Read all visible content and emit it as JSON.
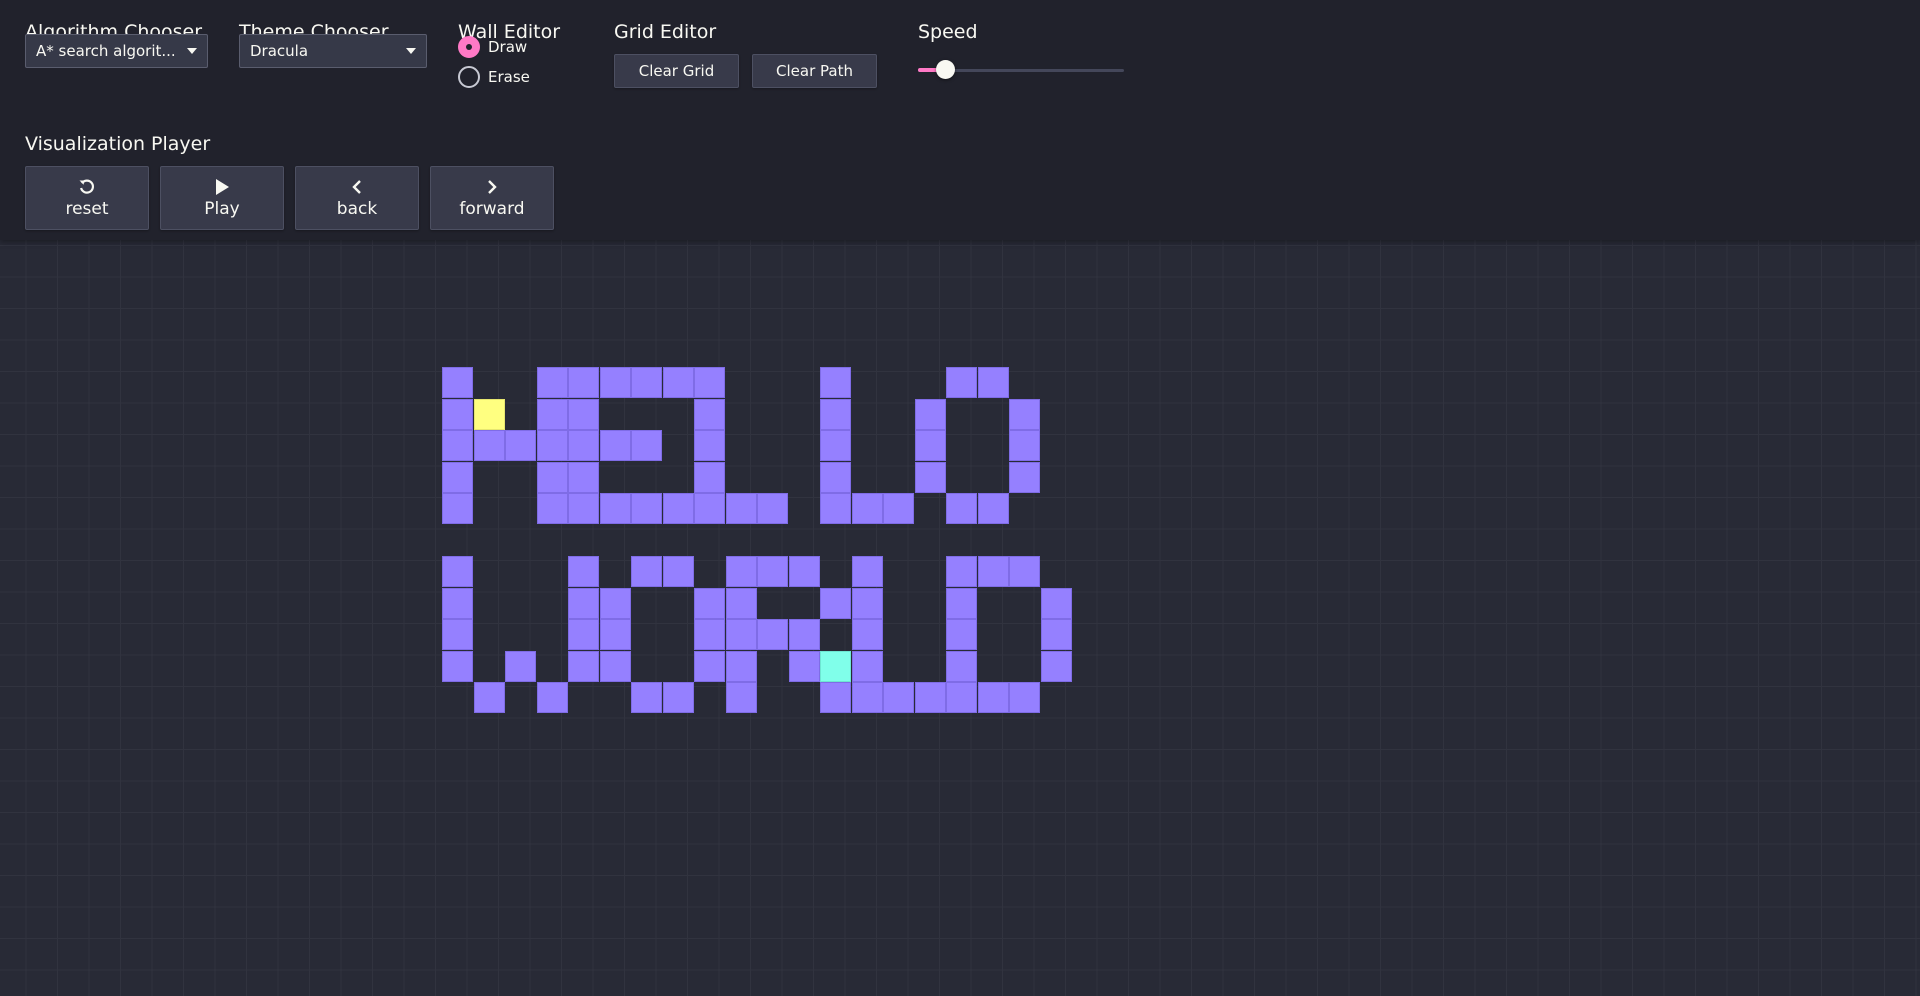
{
  "toolbar": {
    "algorithm": {
      "title": "Algorithm Chooser",
      "selected": "A* search algorit..."
    },
    "theme": {
      "title": "Theme Chooser",
      "selected": "Dracula"
    },
    "wall_editor": {
      "title": "Wall Editor",
      "options": [
        {
          "label": "Draw",
          "checked": true
        },
        {
          "label": "Erase",
          "checked": false
        }
      ]
    },
    "grid_editor": {
      "title": "Grid Editor",
      "clear_grid": "Clear Grid",
      "clear_path": "Clear Path"
    },
    "speed": {
      "title": "Speed",
      "value_fraction": 0.13
    },
    "player": {
      "title": "Visualization Player",
      "buttons": [
        {
          "label": "reset",
          "icon": "reset-icon"
        },
        {
          "label": "Play",
          "icon": "play-icon"
        },
        {
          "label": "back",
          "icon": "chevron-left-icon"
        },
        {
          "label": "forward",
          "icon": "chevron-right-icon"
        }
      ]
    }
  },
  "theme_colors": {
    "background": "#282a36",
    "toolbar": "#21222c",
    "wall": "#9580ff",
    "start_node": "#ffff80",
    "end_node": "#80ffea",
    "accent": "#ff79c6"
  },
  "grid": {
    "walls": [
      [
        11,
        3
      ],
      [
        11,
        4
      ],
      [
        11,
        5
      ],
      [
        11,
        6
      ],
      [
        11,
        7
      ],
      [
        12,
        5
      ],
      [
        13,
        5
      ],
      [
        14,
        3
      ],
      [
        14,
        4
      ],
      [
        14,
        5
      ],
      [
        14,
        6
      ],
      [
        14,
        7
      ],
      [
        15,
        3
      ],
      [
        15,
        4
      ],
      [
        15,
        5
      ],
      [
        15,
        6
      ],
      [
        15,
        7
      ],
      [
        16,
        3
      ],
      [
        17,
        3
      ],
      [
        18,
        3
      ],
      [
        16,
        5
      ],
      [
        17,
        5
      ],
      [
        16,
        7
      ],
      [
        17,
        7
      ],
      [
        18,
        7
      ],
      [
        19,
        3
      ],
      [
        19,
        4
      ],
      [
        19,
        5
      ],
      [
        19,
        6
      ],
      [
        19,
        7
      ],
      [
        20,
        7
      ],
      [
        21,
        7
      ],
      [
        23,
        3
      ],
      [
        23,
        4
      ],
      [
        23,
        5
      ],
      [
        23,
        6
      ],
      [
        23,
        7
      ],
      [
        24,
        7
      ],
      [
        25,
        7
      ],
      [
        27,
        3
      ],
      [
        28,
        3
      ],
      [
        26,
        4
      ],
      [
        26,
        5
      ],
      [
        26,
        6
      ],
      [
        29,
        4
      ],
      [
        29,
        5
      ],
      [
        29,
        6
      ],
      [
        27,
        7
      ],
      [
        28,
        7
      ],
      [
        11,
        9
      ],
      [
        11,
        10
      ],
      [
        11,
        11
      ],
      [
        11,
        12
      ],
      [
        12,
        13
      ],
      [
        13,
        12
      ],
      [
        14,
        13
      ],
      [
        15,
        9
      ],
      [
        15,
        10
      ],
      [
        15,
        11
      ],
      [
        15,
        12
      ],
      [
        17,
        9
      ],
      [
        18,
        9
      ],
      [
        16,
        10
      ],
      [
        16,
        11
      ],
      [
        16,
        12
      ],
      [
        19,
        10
      ],
      [
        19,
        11
      ],
      [
        19,
        12
      ],
      [
        17,
        13
      ],
      [
        18,
        13
      ],
      [
        20,
        9
      ],
      [
        20,
        10
      ],
      [
        20,
        11
      ],
      [
        20,
        12
      ],
      [
        20,
        13
      ],
      [
        21,
        9
      ],
      [
        22,
        9
      ],
      [
        23,
        10
      ],
      [
        21,
        11
      ],
      [
        22,
        11
      ],
      [
        22,
        12
      ],
      [
        23,
        13
      ],
      [
        24,
        9
      ],
      [
        24,
        10
      ],
      [
        24,
        11
      ],
      [
        24,
        12
      ],
      [
        24,
        13
      ],
      [
        25,
        13
      ],
      [
        26,
        13
      ],
      [
        27,
        9
      ],
      [
        27,
        10
      ],
      [
        27,
        11
      ],
      [
        27,
        12
      ],
      [
        27,
        13
      ],
      [
        28,
        9
      ],
      [
        29,
        9
      ],
      [
        30,
        10
      ],
      [
        30,
        11
      ],
      [
        30,
        12
      ],
      [
        28,
        13
      ],
      [
        29,
        13
      ]
    ],
    "start": [
      12,
      4
    ],
    "end": [
      23,
      12
    ]
  }
}
